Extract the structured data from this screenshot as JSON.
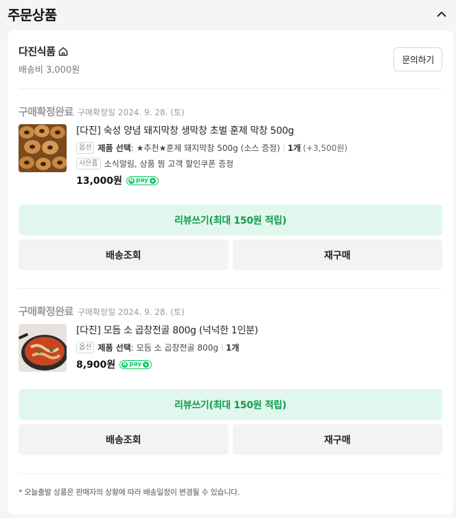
{
  "section": {
    "title": "주문상품",
    "collapse_icon": "chevron-up-icon"
  },
  "seller": {
    "name": "다진식품",
    "home_icon": "home-icon",
    "shipping_fee": "배송비 3,000원",
    "inquiry_label": "문의하기"
  },
  "orders": [
    {
      "status": "구매확정완료",
      "confirm_date": "구매확정일 2024. 9. 28. (토)",
      "product_name": "[다진] 숙성 양념 돼지막창 생막창 초벌 훈제 막창 500g",
      "option_tag": "옵션",
      "option_label": "제품 선택",
      "option_value": ": ★추천★훈제 돼지막창 500g (소스 증정)",
      "quantity": "1개",
      "extra_price": "(+3,500원)",
      "gift_tag": "사은품",
      "gift_text": "소식알림, 상품 찜 고객 할인쿠폰 증정",
      "price": "13,000원",
      "npay_label": "pay",
      "review_label": "리뷰쓰기(최대 150원 적립)",
      "track_label": "배송조회",
      "rebuy_label": "재구매"
    },
    {
      "status": "구매확정완료",
      "confirm_date": "구매확정일 2024. 9. 28. (토)",
      "product_name": "[다진] 모듬 소 곱창전골 800g (넉넉한 1인분)",
      "option_tag": "옵션",
      "option_label": "제품 선택",
      "option_value": ": 모듬 소 곱창전골 800g",
      "quantity": "1개",
      "price": "8,900원",
      "npay_label": "pay",
      "review_label": "리뷰쓰기(최대 150원 적립)",
      "track_label": "배송조회",
      "rebuy_label": "재구매"
    }
  ],
  "notice": "* 오늘출발 상품은 판매자의 상황에 따라 배송일정이 변경될 수 있습니다.",
  "colors": {
    "accent_green": "#03c75a",
    "review_bg": "#e1f6ec",
    "review_text": "#0f9d4a"
  }
}
